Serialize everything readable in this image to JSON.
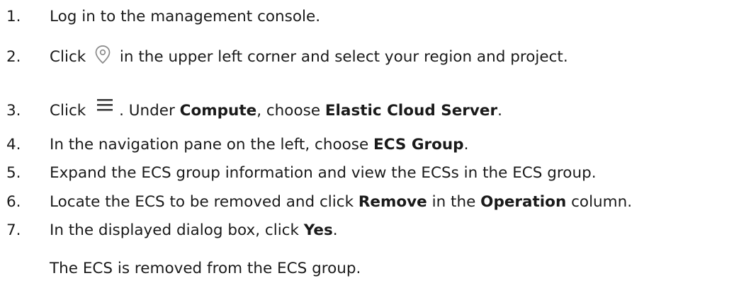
{
  "steps": [
    {
      "number": "1.",
      "parts": [
        {
          "text": "Log in to the management console."
        }
      ]
    },
    {
      "number": "2.",
      "parts": [
        {
          "text": "Click "
        },
        {
          "icon": "location-pin-icon"
        },
        {
          "text": " in the upper left corner and select your region and project."
        }
      ]
    },
    {
      "number": "3.",
      "parts": [
        {
          "text": "Click "
        },
        {
          "icon": "menu-icon"
        },
        {
          "text": ". Under "
        },
        {
          "text": "Compute",
          "bold": true
        },
        {
          "text": ", choose "
        },
        {
          "text": "Elastic Cloud Server",
          "bold": true
        },
        {
          "text": "."
        }
      ]
    },
    {
      "number": "4.",
      "parts": [
        {
          "text": "In the navigation pane on the left, choose "
        },
        {
          "text": "ECS Group",
          "bold": true
        },
        {
          "text": "."
        }
      ]
    },
    {
      "number": "5.",
      "parts": [
        {
          "text": "Expand the ECS group information and view the ECSs in the ECS group."
        }
      ]
    },
    {
      "number": "6.",
      "parts": [
        {
          "text": "Locate the ECS to be removed and click "
        },
        {
          "text": "Remove",
          "bold": true
        },
        {
          "text": " in the "
        },
        {
          "text": "Operation",
          "bold": true
        },
        {
          "text": " column."
        }
      ]
    },
    {
      "number": "7.",
      "parts": [
        {
          "text": "In the displayed dialog box, click "
        },
        {
          "text": "Yes",
          "bold": true
        },
        {
          "text": "."
        }
      ]
    }
  ],
  "result_note": "The ECS is removed from the ECS group."
}
